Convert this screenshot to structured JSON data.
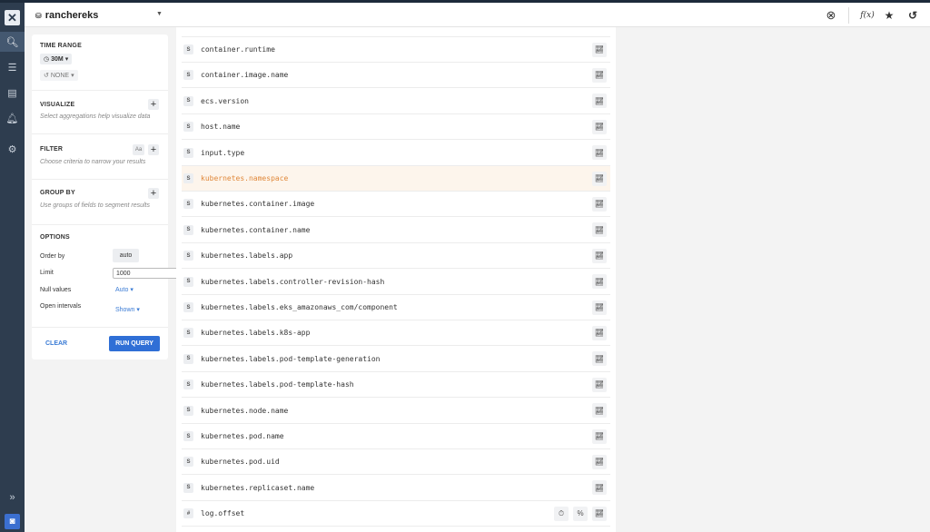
{
  "app": {
    "logo_glyph": "✕",
    "nav_rail": [
      {
        "icon": "search-icon",
        "glyph": "🔍︎",
        "active": true
      },
      {
        "icon": "list-icon",
        "glyph": "☰",
        "active": false
      },
      {
        "icon": "board-icon",
        "glyph": "▤",
        "active": false
      },
      {
        "icon": "bell-icon",
        "glyph": "🔔︎",
        "active": false
      },
      {
        "icon": "gear-icon",
        "glyph": "⚙",
        "active": false
      }
    ],
    "expand_glyph": "»",
    "avatar_glyph": "◙"
  },
  "header": {
    "dataset_icon": "database-icon",
    "dataset_glyph": "⛁",
    "dataset_name": "ranchereks",
    "caret_glyph": "▼",
    "close_glyph": "⊗",
    "fx_label": "f(x)",
    "star_glyph": "★",
    "history_glyph": "↺"
  },
  "query_panel": {
    "time_range": {
      "title": "TIME RANGE",
      "clock_glyph": "◷",
      "value": "30M",
      "compare_glyph": "↺",
      "compare_value": "NONE"
    },
    "visualize": {
      "title": "VISUALIZE",
      "hint": "Select aggregations help visualize data"
    },
    "filter": {
      "title": "FILTER",
      "hint": "Choose criteria to narrow your results",
      "case_label": "Aa"
    },
    "group_by": {
      "title": "GROUP BY",
      "hint": "Use groups of fields to segment results"
    },
    "options": {
      "title": "OPTIONS",
      "order_by_label": "Order by",
      "order_by_value": "auto",
      "limit_label": "Limit",
      "limit_value": "1000",
      "null_values_label": "Null values",
      "null_values_value": "Auto",
      "open_intervals_label": "Open intervals",
      "open_intervals_value": "Shown"
    },
    "clear_label": "CLEAR",
    "run_label": "RUN QUERY",
    "plus_glyph": "+",
    "caret_glyph": "▾"
  },
  "fields": {
    "chart_glyph": "📈︎",
    "timer_glyph": "⏱︎",
    "percent_glyph": "%",
    "rows": [
      {
        "type": "S",
        "name": "container.runtime",
        "highlighted": false
      },
      {
        "type": "S",
        "name": "container.image.name",
        "highlighted": false
      },
      {
        "type": "S",
        "name": "ecs.version",
        "highlighted": false
      },
      {
        "type": "S",
        "name": "host.name",
        "highlighted": false
      },
      {
        "type": "S",
        "name": "input.type",
        "highlighted": false
      },
      {
        "type": "S",
        "name": "kubernetes.namespace",
        "highlighted": true
      },
      {
        "type": "S",
        "name": "kubernetes.container.image",
        "highlighted": false
      },
      {
        "type": "S",
        "name": "kubernetes.container.name",
        "highlighted": false
      },
      {
        "type": "S",
        "name": "kubernetes.labels.app",
        "highlighted": false
      },
      {
        "type": "S",
        "name": "kubernetes.labels.controller-revision-hash",
        "highlighted": false
      },
      {
        "type": "S",
        "name": "kubernetes.labels.eks_amazonaws_com/component",
        "highlighted": false
      },
      {
        "type": "S",
        "name": "kubernetes.labels.k8s-app",
        "highlighted": false
      },
      {
        "type": "S",
        "name": "kubernetes.labels.pod-template-generation",
        "highlighted": false
      },
      {
        "type": "S",
        "name": "kubernetes.labels.pod-template-hash",
        "highlighted": false
      },
      {
        "type": "S",
        "name": "kubernetes.node.name",
        "highlighted": false
      },
      {
        "type": "S",
        "name": "kubernetes.pod.name",
        "highlighted": false
      },
      {
        "type": "S",
        "name": "kubernetes.pod.uid",
        "highlighted": false
      },
      {
        "type": "S",
        "name": "kubernetes.replicaset.name",
        "highlighted": false
      },
      {
        "type": "#",
        "name": "log.offset",
        "highlighted": false
      }
    ]
  }
}
